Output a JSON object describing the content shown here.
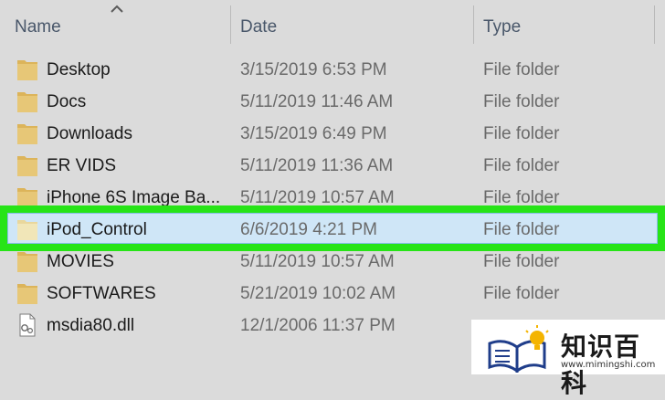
{
  "header": {
    "name_label": "Name",
    "date_label": "Date",
    "type_label": "Type"
  },
  "rows": [
    {
      "name": "Desktop",
      "date": "3/15/2019 6:53 PM",
      "type": "File folder",
      "icon": "folder-icon",
      "selected": false
    },
    {
      "name": "Docs",
      "date": "5/11/2019 11:46 AM",
      "type": "File folder",
      "icon": "folder-icon",
      "selected": false
    },
    {
      "name": "Downloads",
      "date": "3/15/2019 6:49 PM",
      "type": "File folder",
      "icon": "folder-icon",
      "selected": false
    },
    {
      "name": "ER VIDS",
      "date": "5/11/2019 11:36 AM",
      "type": "File folder",
      "icon": "folder-icon",
      "selected": false
    },
    {
      "name": "iPhone 6S Image Ba...",
      "date": "5/11/2019 10:57 AM",
      "type": "File folder",
      "icon": "folder-icon",
      "selected": false
    },
    {
      "name": "iPod_Control",
      "date": "6/6/2019 4:21 PM",
      "type": "File folder",
      "icon": "folder-icon",
      "selected": true
    },
    {
      "name": "MOVIES",
      "date": "5/11/2019 10:57 AM",
      "type": "File folder",
      "icon": "folder-icon",
      "selected": false
    },
    {
      "name": "SOFTWARES",
      "date": "5/21/2019 10:02 AM",
      "type": "File folder",
      "icon": "folder-icon",
      "selected": false
    },
    {
      "name": "msdia80.dll",
      "date": "12/1/2006 11:37 PM",
      "type": "",
      "icon": "dll-file-icon",
      "selected": false
    }
  ],
  "watermark": {
    "text": "知识百科",
    "url": "www.mimingshi.com"
  },
  "colors": {
    "background": "#dbdbdb",
    "highlight_frame": "#27e417",
    "selection_fill": "#cfe6f7",
    "folder": "#dcb45a"
  }
}
